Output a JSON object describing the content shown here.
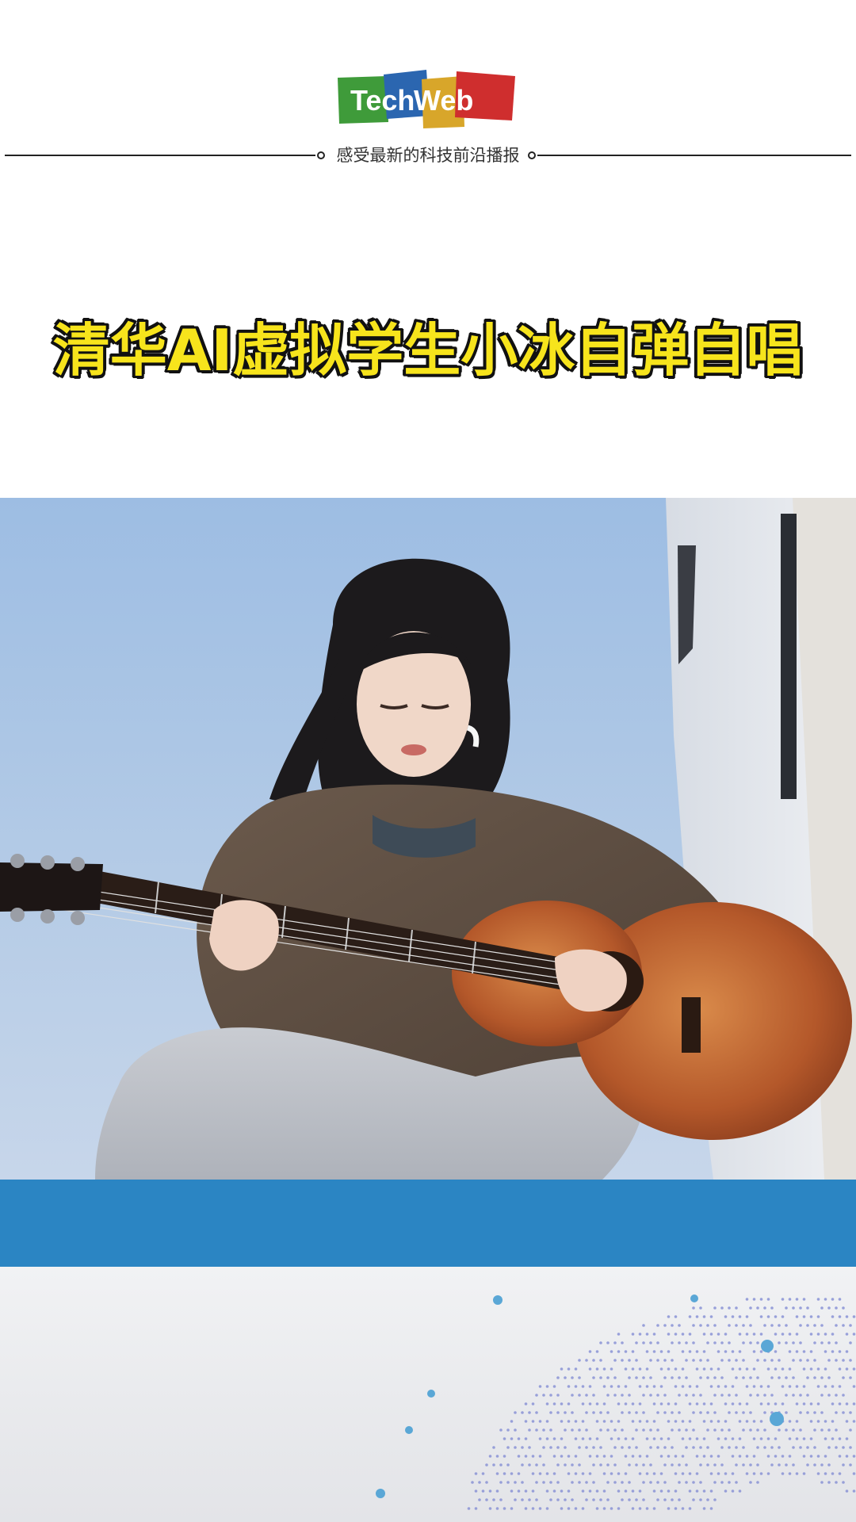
{
  "header": {
    "logo": {
      "part1": "Tech",
      "part2": "Web",
      "colors": {
        "green": "#3f9b3a",
        "blue": "#2b66b0",
        "gold": "#d8a62a",
        "red": "#cf2e2e"
      }
    },
    "tagline": "感受最新的科技前沿播报",
    "headline": "清华AI虚拟学生小冰自弹自唱",
    "headline_color": "#f7e41c"
  },
  "video": {
    "subject": "girl-playing-acoustic-guitar",
    "background": "sky"
  },
  "colors": {
    "bar": "#2b85c3",
    "footer": "#e8e9ec"
  }
}
